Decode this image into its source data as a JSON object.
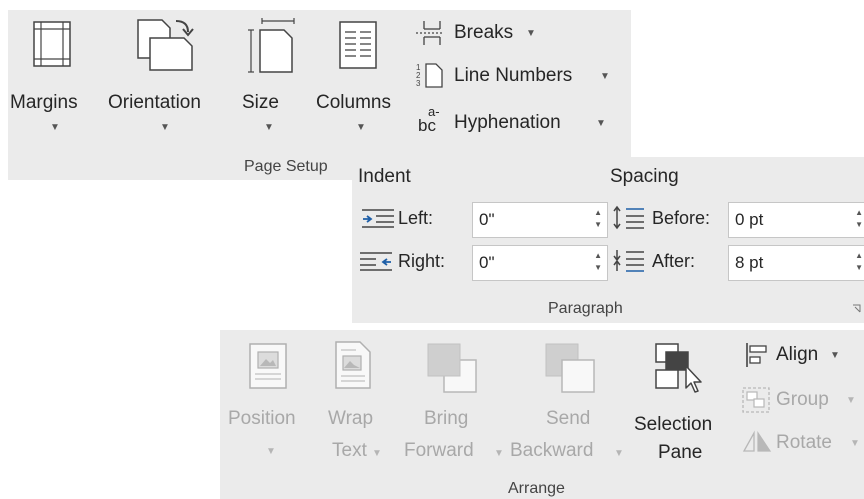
{
  "page_setup": {
    "margins": "Margins",
    "orientation": "Orientation",
    "size": "Size",
    "columns": "Columns",
    "breaks": "Breaks",
    "line_numbers": "Line Numbers",
    "hyphenation": "Hyphenation",
    "group_label": "Page Setup"
  },
  "paragraph": {
    "indent_header": "Indent",
    "spacing_header": "Spacing",
    "left_label": "Left:",
    "left_value": "0\"",
    "right_label": "Right:",
    "right_value": "0\"",
    "before_label": "Before:",
    "before_value": "0 pt",
    "after_label": "After:",
    "after_value": "8 pt",
    "group_label": "Paragraph"
  },
  "arrange": {
    "position": "Position",
    "wrap_1": "Wrap",
    "wrap_2": "Text",
    "bring_1": "Bring",
    "bring_2": "Forward",
    "send_1": "Send",
    "send_2": "Backward",
    "selection_1": "Selection",
    "selection_2": "Pane",
    "align": "Align",
    "group": "Group",
    "rotate": "Rotate",
    "group_label": "Arrange"
  }
}
